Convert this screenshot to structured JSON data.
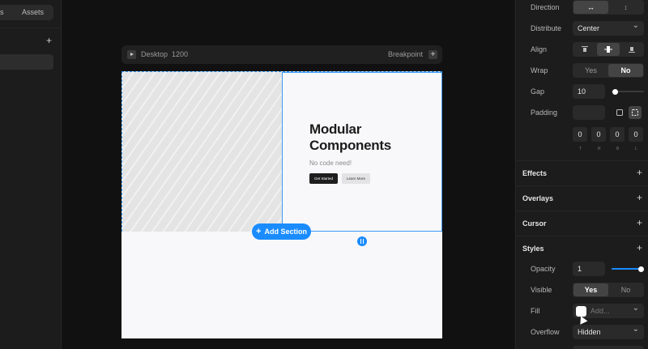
{
  "left_panel": {
    "tab_pages": "s",
    "tab_assets": "Assets",
    "add_symbol": "+"
  },
  "frame": {
    "device": "Desktop",
    "width_value": "1200",
    "breakpoint_label": "Breakpoint",
    "add_symbol": "+"
  },
  "hero": {
    "title": "Modular Components",
    "subtitle": "No code need!",
    "primary_button": "Get Started",
    "secondary_button": "Learn More"
  },
  "canvas": {
    "add_section_label": "Add Section",
    "add_section_symbol": "+"
  },
  "layout": {
    "direction_label": "Direction",
    "direction_horizontal": "↔",
    "direction_vertical": "↕",
    "distribute_label": "Distribute",
    "distribute_value": "Center",
    "align_label": "Align",
    "wrap_label": "Wrap",
    "wrap_yes": "Yes",
    "wrap_no": "No",
    "gap_label": "Gap",
    "gap_value": "10",
    "gap_slider_fraction": 0.12,
    "padding_label": "Padding",
    "padding_values": [
      "0",
      "0",
      "0",
      "0"
    ],
    "padding_captions": [
      "T",
      "R",
      "B",
      "L"
    ]
  },
  "sections": {
    "effects": "Effects",
    "overlays": "Overlays",
    "cursor": "Cursor",
    "styles": "Styles",
    "add_symbol": "+"
  },
  "styles": {
    "opacity_label": "Opacity",
    "opacity_value": "1",
    "opacity_slider_fraction": 1.0,
    "visible_label": "Visible",
    "visible_yes": "Yes",
    "visible_no": "No",
    "fill_label": "Fill",
    "fill_placeholder": "Add...",
    "overflow_label": "Overflow",
    "overflow_value": "Hidden"
  },
  "colors": {
    "accent": "#1a8cff",
    "canvas_bg": "#111111",
    "panel_bg": "#1c1c1c",
    "page_bg": "#f8f8fa"
  },
  "icons": {
    "play": "play-icon",
    "align_top": "align-top-icon",
    "align_center": "align-center-icon",
    "align_bottom": "align-bottom-icon",
    "padding_uniform": "padding-uniform-icon",
    "padding_individual": "padding-individual-icon",
    "resize_handle": "resize-handle-icon",
    "cursor": "mouse-pointer-icon"
  }
}
